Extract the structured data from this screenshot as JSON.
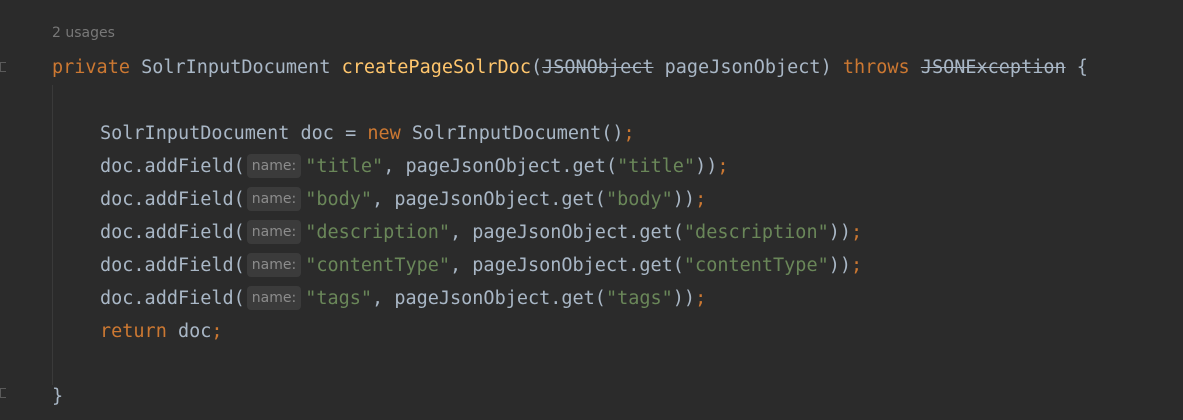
{
  "editor": {
    "usages": "2 usages",
    "sig": {
      "kw_private": "private",
      "type": "SolrInputDocument",
      "method": "createPageSolrDoc",
      "open_paren": "(",
      "param_type": "JSONObject",
      "param_name": "pageJsonObject",
      "close_paren": ")",
      "kw_throws": "throws",
      "exception": "JSONException",
      "brace": "{"
    },
    "decl": {
      "type": "SolrInputDocument",
      "var": "doc",
      "eq": "=",
      "kw_new": "new",
      "ctor": "SolrInputDocument()",
      "semi": ";"
    },
    "param_hint": "name:",
    "add_calls": [
      {
        "prefix": "doc.addField(",
        "key": "\"title\"",
        "mid": ", pageJsonObject.get(",
        "arg": "\"title\"",
        "suffix": "))",
        "semi": ";"
      },
      {
        "prefix": "doc.addField(",
        "key": "\"body\"",
        "mid": ", pageJsonObject.get(",
        "arg": "\"body\"",
        "suffix": "))",
        "semi": ";"
      },
      {
        "prefix": "doc.addField(",
        "key": "\"description\"",
        "mid": ", pageJsonObject.get(",
        "arg": "\"description\"",
        "suffix": "))",
        "semi": ";"
      },
      {
        "prefix": "doc.addField(",
        "key": "\"contentType\"",
        "mid": ", pageJsonObject.get(",
        "arg": "\"contentType\"",
        "suffix": "))",
        "semi": ";"
      },
      {
        "prefix": "doc.addField(",
        "key": "\"tags\"",
        "mid": ", pageJsonObject.get(",
        "arg": "\"tags\"",
        "suffix": "))",
        "semi": ";"
      }
    ],
    "ret": {
      "kw_return": "return",
      "value": "doc",
      "semi": ";"
    },
    "close_brace": "}"
  }
}
